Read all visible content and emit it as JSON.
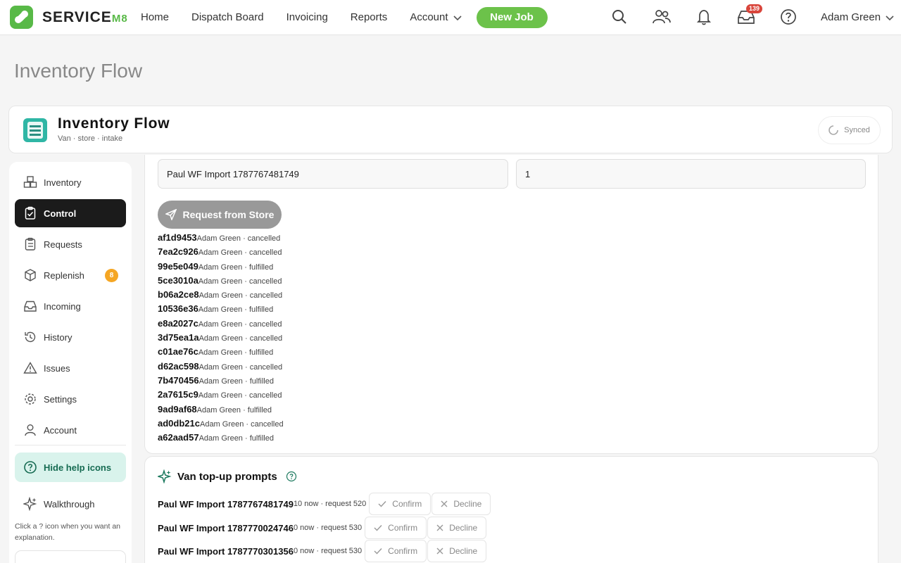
{
  "brand": {
    "name": "SERVICE",
    "suffix": "M8"
  },
  "nav": {
    "links": [
      "Home",
      "Dispatch Board",
      "Invoicing",
      "Reports"
    ],
    "account": "Account",
    "new_job": "New Job",
    "notification_count": "139",
    "user": "Adam Green"
  },
  "page": {
    "title": "Inventory Flow"
  },
  "app": {
    "title": "Inventory Flow",
    "subtitle": "Van · store · intake",
    "sync_status": "Synced"
  },
  "sidebar": {
    "items": [
      {
        "label": "Inventory",
        "icon": "boxes-icon"
      },
      {
        "label": "Control",
        "icon": "clipboard-check-icon",
        "active": true
      },
      {
        "label": "Requests",
        "icon": "clipboard-list-icon"
      },
      {
        "label": "Replenish",
        "icon": "package-icon",
        "badge": "8"
      },
      {
        "label": "Incoming",
        "icon": "inbox-icon"
      },
      {
        "label": "History",
        "icon": "history-icon"
      },
      {
        "label": "Issues",
        "icon": "warning-icon"
      },
      {
        "label": "Settings",
        "icon": "gear-icon"
      },
      {
        "label": "Account",
        "icon": "user-icon"
      }
    ],
    "help_toggle": "Hide help icons",
    "walkthrough": "Walkthrough",
    "help_text": "Click a ? icon when you want an explanation."
  },
  "request_form": {
    "item_value": "Paul WF Import 1787767481749",
    "quantity_value": "1",
    "submit_label": "Request from Store"
  },
  "requests": [
    {
      "id": "af1d9453",
      "meta": "Adam Green · cancelled"
    },
    {
      "id": "7ea2c926",
      "meta": "Adam Green · cancelled"
    },
    {
      "id": "99e5e049",
      "meta": "Adam Green · fulfilled"
    },
    {
      "id": "5ce3010a",
      "meta": "Adam Green · cancelled"
    },
    {
      "id": "b06a2ce8",
      "meta": "Adam Green · cancelled"
    },
    {
      "id": "10536e36",
      "meta": "Adam Green · fulfilled"
    },
    {
      "id": "e8a2027c",
      "meta": "Adam Green · cancelled"
    },
    {
      "id": "3d75ea1a",
      "meta": "Adam Green · cancelled"
    },
    {
      "id": "c01ae76c",
      "meta": "Adam Green · fulfilled"
    },
    {
      "id": "d62ac598",
      "meta": "Adam Green · cancelled"
    },
    {
      "id": "7b470456",
      "meta": "Adam Green · fulfilled"
    },
    {
      "id": "2a7615c9",
      "meta": "Adam Green · cancelled"
    },
    {
      "id": "9ad9af68",
      "meta": "Adam Green · fulfilled"
    },
    {
      "id": "ad0db21c",
      "meta": "Adam Green · cancelled"
    },
    {
      "id": "a62aad57",
      "meta": "Adam Green · fulfilled"
    }
  ],
  "prompts": {
    "title": "Van top-up prompts",
    "confirm_label": "Confirm",
    "decline_label": "Decline",
    "rows": [
      {
        "name": "Paul WF Import 1787767481749",
        "meta": "10 now · request 520"
      },
      {
        "name": "Paul WF Import 1787770024746",
        "meta": "0 now · request 530"
      },
      {
        "name": "Paul WF Import 1787770301356",
        "meta": "0 now · request 530"
      }
    ]
  },
  "colors": {
    "brand_green": "#6cc24a",
    "active_nav": "#1b1b1b",
    "badge_orange": "#f5a623",
    "help_green": "#d9f3ec",
    "alert_red": "#d9453b"
  }
}
